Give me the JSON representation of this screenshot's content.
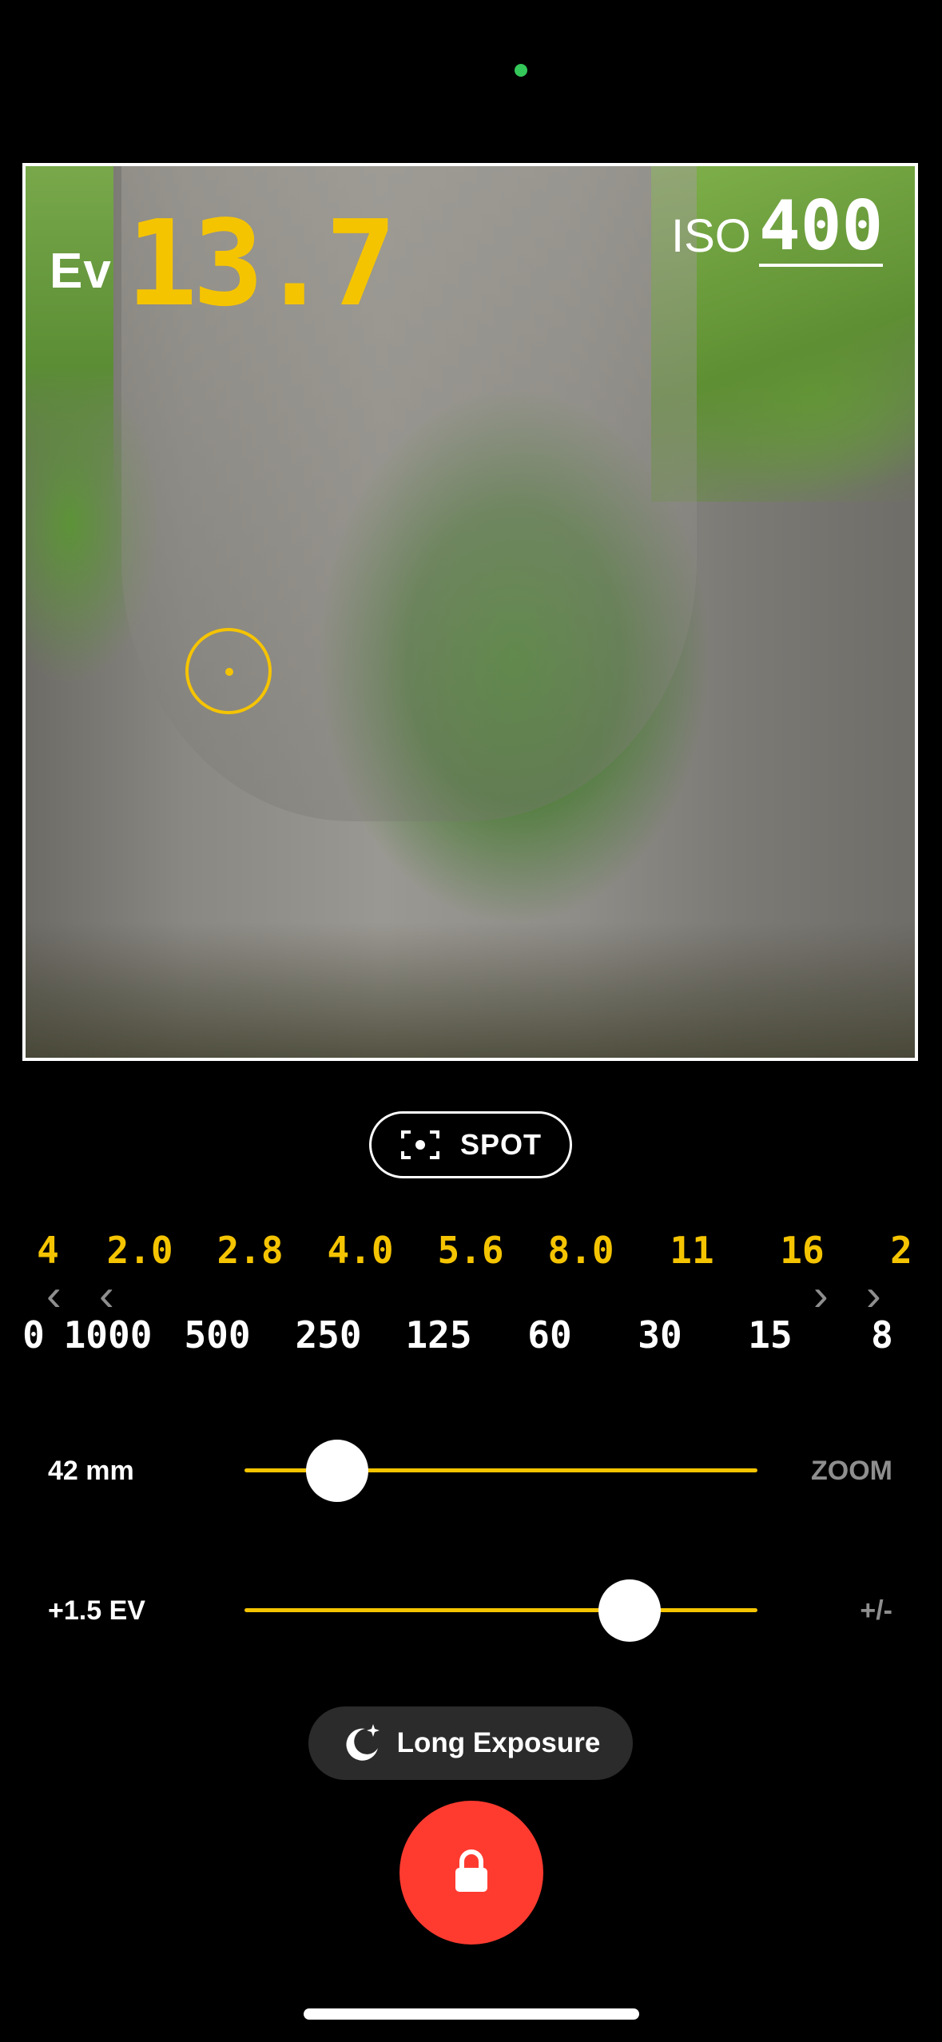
{
  "meter": {
    "ev_label": "Ev",
    "ev_value": "13.7",
    "iso_label": "ISO",
    "iso_value": "400"
  },
  "metering_mode": {
    "label": "SPOT",
    "icon": "spot-meter-icon"
  },
  "aperture_scale": [
    "4",
    "2.0",
    "2.8",
    "4.0",
    "5.6",
    "8.0",
    "11",
    "16",
    "2"
  ],
  "shutter_scale": [
    "0",
    "1000",
    "500",
    "250",
    "125",
    "60",
    "30",
    "15",
    "8"
  ],
  "nav": {
    "left_icons": [
      "chevron-left-icon",
      "chevron-left-icon"
    ],
    "right_icons": [
      "chevron-right-icon",
      "chevron-right-icon"
    ]
  },
  "zoom": {
    "value_label": "42 mm",
    "tag": "ZOOM",
    "level": 0.18
  },
  "exposure": {
    "value_label": "+1.5 EV",
    "tag": "+/-",
    "level": 0.75
  },
  "long_exposure": {
    "label": "Long Exposure",
    "icon": "moon-stars-icon"
  },
  "shutter_button": {
    "icon": "lock-icon"
  },
  "colors": {
    "accent": "#f5c400",
    "record": "#ff3b30",
    "status_dot": "#34c759"
  }
}
